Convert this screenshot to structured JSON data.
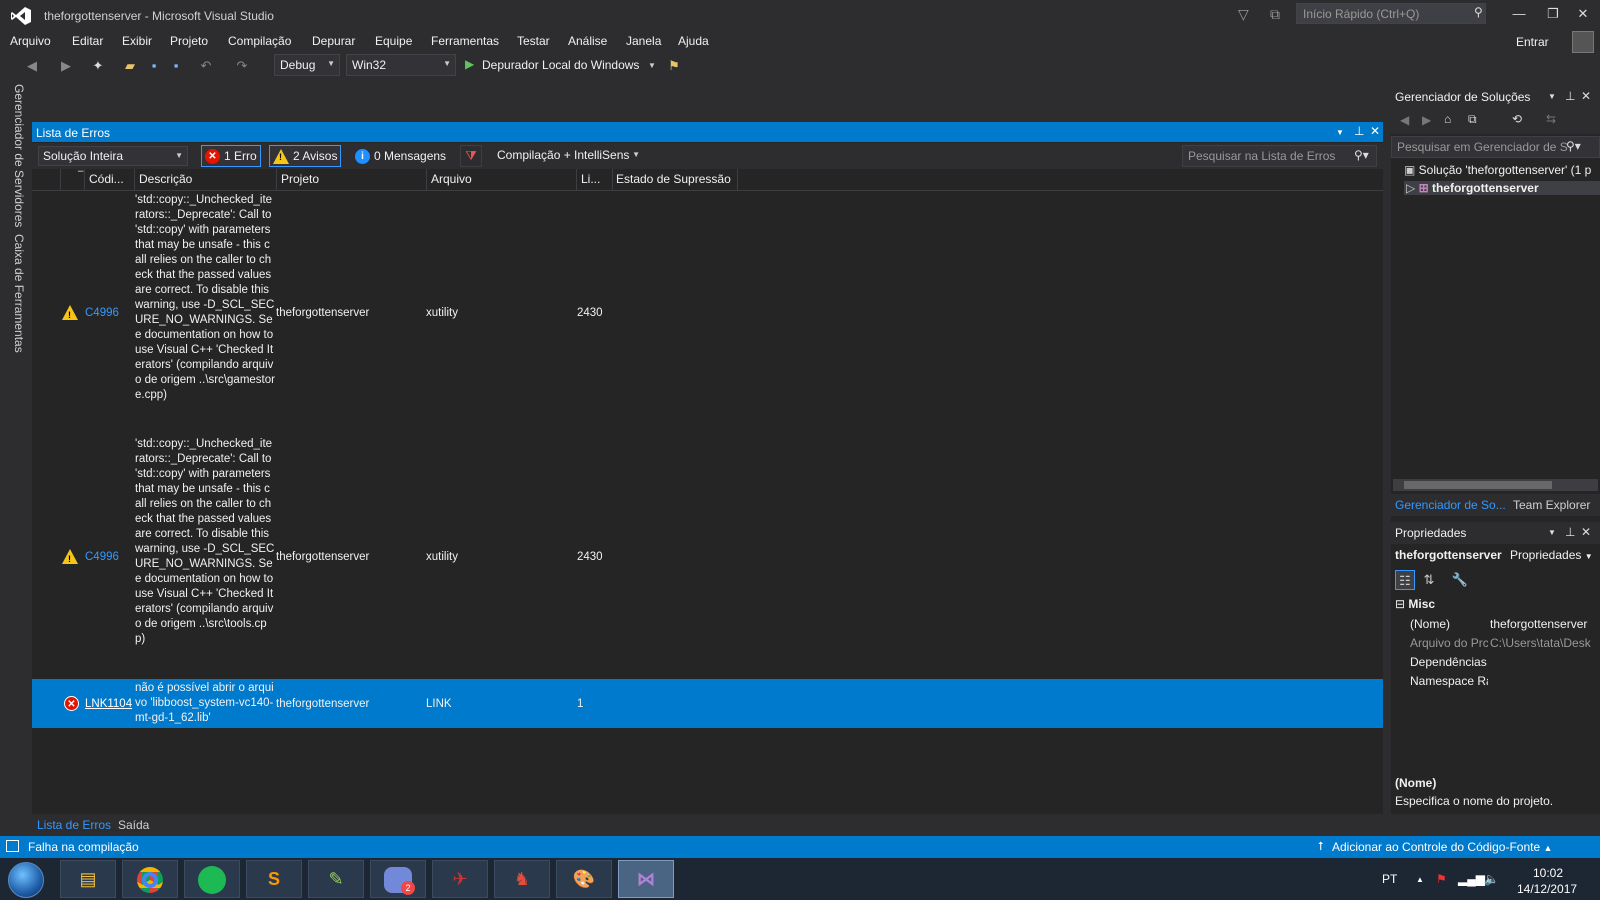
{
  "window": {
    "title": "theforgottenserver - Microsoft Visual Studio"
  },
  "quick_launch": {
    "placeholder": "Início Rápido (Ctrl+Q)"
  },
  "menu": [
    "Arquivo",
    "Editar",
    "Exibir",
    "Projeto",
    "Compilação",
    "Depurar",
    "Equipe",
    "Ferramentas",
    "Testar",
    "Análise",
    "Janela",
    "Ajuda"
  ],
  "account": {
    "sign_in": "Entrar"
  },
  "toolbar": {
    "configuration": "Debug",
    "platform": "Win32",
    "debugger": "Depurador Local do Windows"
  },
  "side_tabs": {
    "servers": "Gerenciador de Servidores",
    "toolbox": "Caixa de Ferramentas"
  },
  "error_list": {
    "title": "Lista de Erros",
    "scope": "Solução Inteira",
    "errors_label": "1 Erro",
    "warnings_label": "2 Avisos",
    "messages_label": "0 Mensagens",
    "build_filter": "Compilação + IntelliSens",
    "search_placeholder": "Pesquisar na Lista de Erros",
    "columns": [
      "Códi...",
      "Descrição",
      "Projeto",
      "Arquivo",
      "Li...",
      "Estado de Supressão"
    ],
    "rows": [
      {
        "severity": "warning",
        "code": "C4996",
        "description": "'std::copy::_Unchecked_iterators::_Deprecate': Call to 'std::copy' with parameters that may be unsafe - this call relies on the caller to check that the passed values are correct. To disable this warning, use -D_SCL_SECURE_NO_WARNINGS. See documentation on how to use Visual C++ 'Checked Iterators' (compilando arquivo de origem ..\\src\\gamestore.cpp)",
        "project": "theforgottenserver",
        "file": "xutility",
        "line": "2430",
        "suppression": ""
      },
      {
        "severity": "warning",
        "code": "C4996",
        "description": "'std::copy::_Unchecked_iterators::_Deprecate': Call to 'std::copy' with parameters that may be unsafe - this call relies on the caller to check that the passed values are correct. To disable this warning, use -D_SCL_SECURE_NO_WARNINGS. See documentation on how to use Visual C++ 'Checked Iterators' (compilando arquivo de origem ..\\src\\tools.cpp)",
        "project": "theforgottenserver",
        "file": "xutility",
        "line": "2430",
        "suppression": ""
      },
      {
        "severity": "error",
        "code": "LNK1104",
        "description": "não é possível abrir o arquivo 'libboost_system-vc140-mt-gd-1_62.lib'",
        "project": "theforgottenserver",
        "file": "LINK",
        "line": "1",
        "suppression": "",
        "selected": true
      }
    ],
    "bottom_tabs": [
      "Lista de Erros",
      "Saída"
    ]
  },
  "solution_explorer": {
    "title": "Gerenciador de Soluções",
    "search_placeholder": "Pesquisar em Gerenciador de S",
    "root": "Solução 'theforgottenserver' (1 p",
    "project": "theforgottenserver",
    "tabs": [
      "Gerenciador de So...",
      "Team Explorer"
    ]
  },
  "properties": {
    "title": "Propriedades",
    "object": "theforgottenserver",
    "object_type": "Propriedades",
    "category": "Misc",
    "rows": [
      {
        "name": "(Nome)",
        "value": "theforgottenserver"
      },
      {
        "name": "Arquivo do Prc",
        "value": "C:\\Users\\tata\\Desk"
      },
      {
        "name": "Dependências",
        "value": ""
      },
      {
        "name": "Namespace Ra",
        "value": ""
      }
    ],
    "desc_title": "(Nome)",
    "desc_text": "Especifica o nome do projeto."
  },
  "status": {
    "text": "Falha na compilação",
    "source_control": "Adicionar ao Controle do Código-Fonte"
  },
  "taskbar": {
    "language": "PT",
    "time": "10:02",
    "date": "14/12/2017",
    "discord_badge": "2"
  },
  "colors": {
    "accent": "#007acc",
    "error": "#e51400",
    "warning": "#f5c518",
    "link": "#3399ff"
  }
}
